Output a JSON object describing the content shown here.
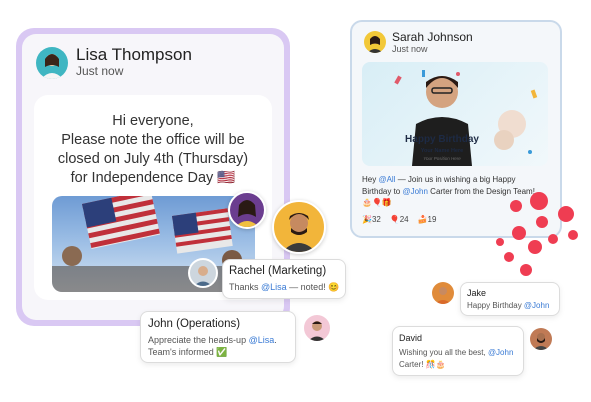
{
  "left_post": {
    "author": "Lisa Thompson",
    "time": "Just now",
    "message_lines": [
      "Hi everyone,",
      "Please note the office will be",
      "closed on July 4th (Thursday)",
      "for Independence Day 🇺🇸"
    ]
  },
  "comments_left": [
    {
      "name": "Rachel (Marketing)",
      "text_pre": "Thanks ",
      "mention": "@Lisa",
      "text_post": " — noted! 😊"
    },
    {
      "name": "John (Operations)",
      "text_pre": "Appreciate the heads-up ",
      "mention": "@Lisa",
      "text_post": ".",
      "line2": "Team's informed ✅"
    }
  ],
  "right_post": {
    "author": "Sarah Johnson",
    "time": "Just now",
    "banner_title": "Happy Birthday",
    "banner_sub": "Your Name Here",
    "banner_sig": "Your Position Here",
    "text_pre": "Hey ",
    "mention1": "@All",
    "text_mid": " — Join us in wishing a big Happy Birthday to ",
    "mention2": "@John",
    "text_post": " Carter from the Design Team! 🎂🎈🎁",
    "reactions": [
      {
        "icon": "🎉",
        "count": "32"
      },
      {
        "icon": "🎈",
        "count": "24"
      },
      {
        "icon": "🍰",
        "count": "19"
      }
    ]
  },
  "comments_right": [
    {
      "name": "Jake",
      "text_pre": "Happy Birthday ",
      "mention": "@John",
      "text_post": ""
    },
    {
      "name": "David",
      "text_pre": "Wishing you all the best, ",
      "mention": "@John",
      "text_post": "",
      "line2": "Carter! 🎊🎂"
    }
  ]
}
